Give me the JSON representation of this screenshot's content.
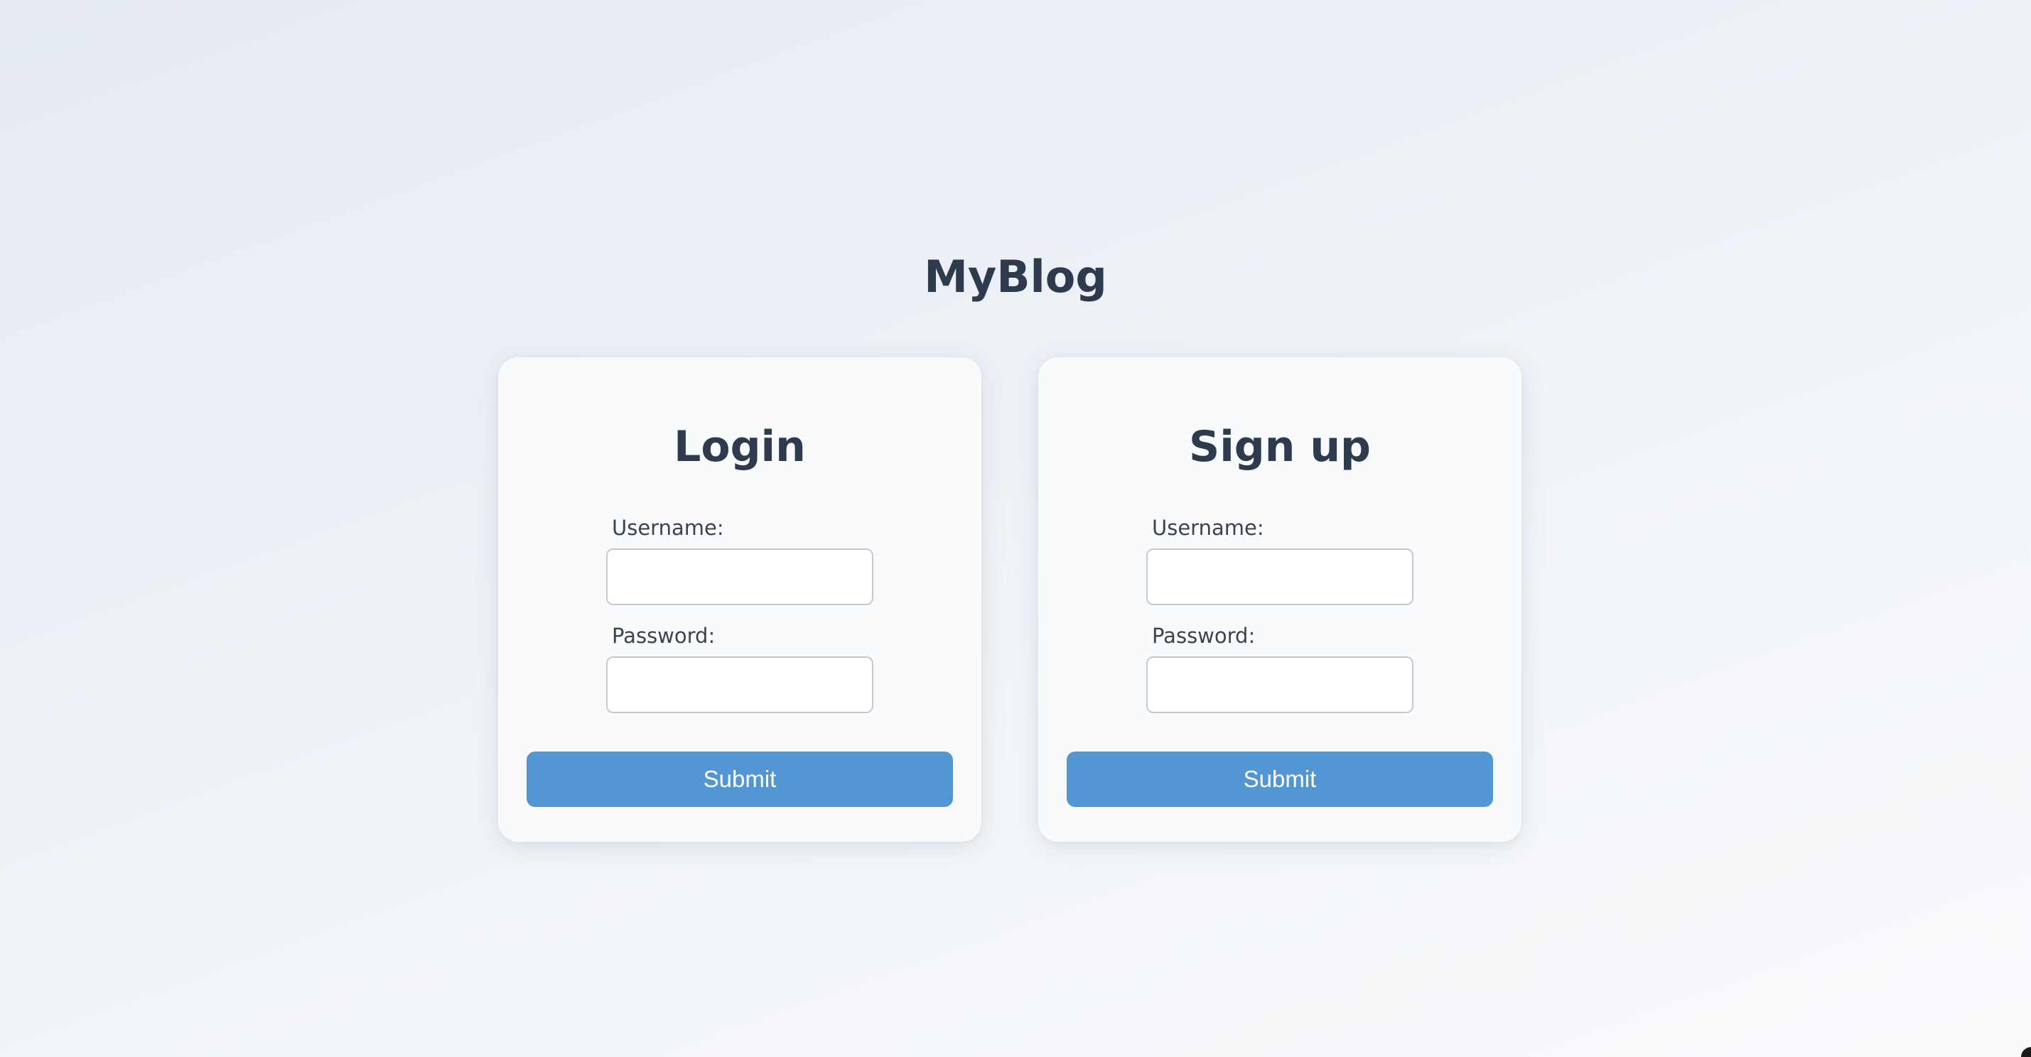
{
  "app": {
    "title": "MyBlog"
  },
  "login": {
    "title": "Login",
    "username_label": "Username:",
    "username_value": "",
    "password_label": "Password:",
    "password_value": "",
    "submit_label": "Submit"
  },
  "signup": {
    "title": "Sign up",
    "username_label": "Username:",
    "username_value": "",
    "password_label": "Password:",
    "password_value": "",
    "submit_label": "Submit"
  },
  "colors": {
    "accent": "#5396d4",
    "heading": "#2e3b4e",
    "card_background": "#f8fafc",
    "input_border": "#c4c9d1"
  }
}
